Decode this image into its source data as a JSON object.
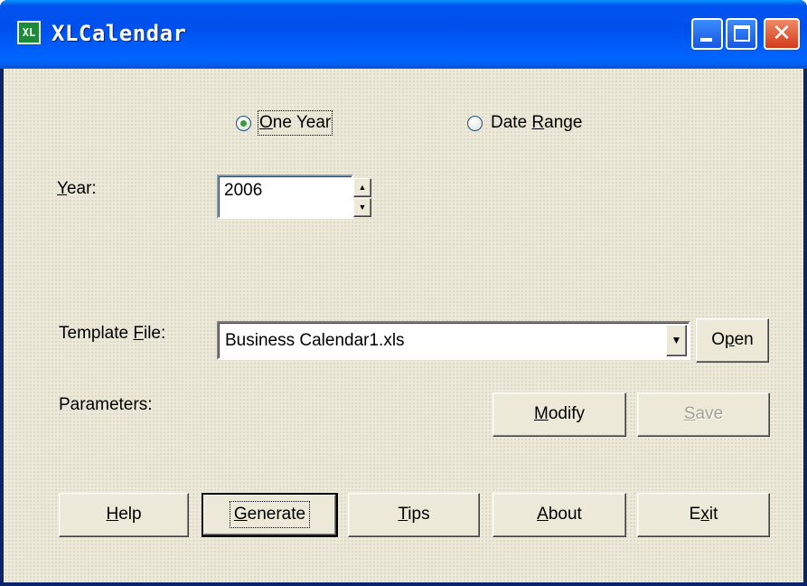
{
  "window": {
    "title": "XLCalendar",
    "icon": "excel-icon",
    "icon_label": "XL",
    "controls": {
      "minimize": "minimize-icon",
      "maximize": "maximize-icon",
      "close": "close-icon"
    }
  },
  "mode": {
    "options": [
      {
        "label_prefix": "",
        "accel": "O",
        "label_suffix": "ne Year",
        "checked": true
      },
      {
        "label_prefix": "Date ",
        "accel": "R",
        "label_suffix": "ange",
        "checked": false
      }
    ]
  },
  "year": {
    "label_accel": "Y",
    "label_suffix": "ear:",
    "value": "2006",
    "up_glyph": "▲",
    "down_glyph": "▼"
  },
  "template": {
    "label_prefix": "Template ",
    "label_accel": "F",
    "label_suffix": "ile:",
    "value": "Business Calendar1.xls",
    "dropdown_glyph": "▼",
    "open_prefix": "O",
    "open_accel": "p",
    "open_suffix": "en"
  },
  "parameters": {
    "label": "Parameters:",
    "modify_accel": "M",
    "modify_suffix": "odify",
    "save_accel": "S",
    "save_suffix": "ave"
  },
  "footer_buttons": {
    "help_accel": "H",
    "help_suffix": "elp",
    "generate_accel": "G",
    "generate_suffix": "enerate",
    "tips_accel": "T",
    "tips_suffix": "ips",
    "about_accel": "A",
    "about_suffix": "bout",
    "exit_prefix": "E",
    "exit_accel": "x",
    "exit_suffix": "it"
  },
  "colors": {
    "titlebar": "#0054e3",
    "client_bg": "#ece9d8",
    "disabled_text": "#a3a193",
    "radio_check": "#3a9a3a"
  }
}
